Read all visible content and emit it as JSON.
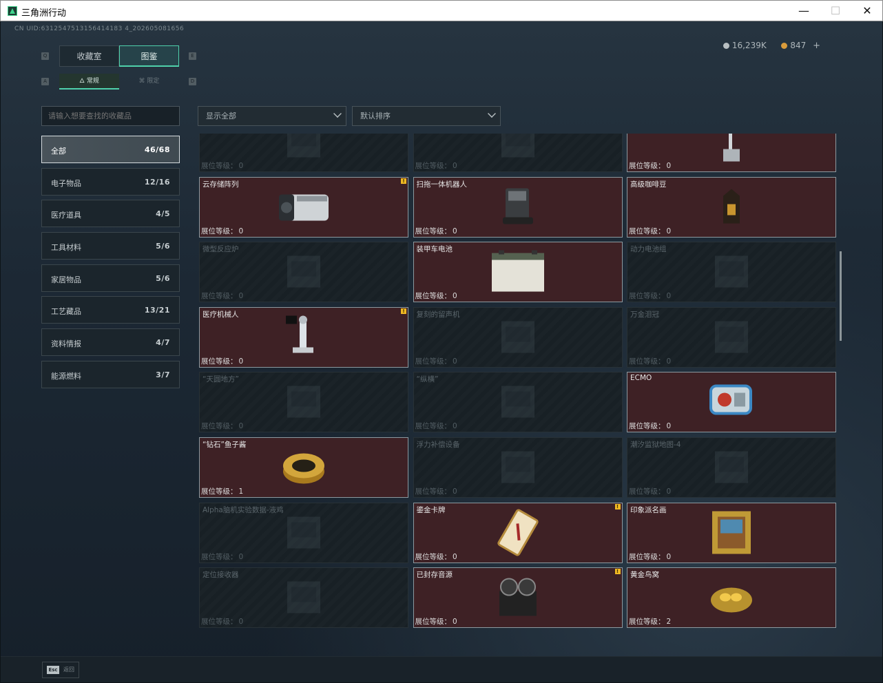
{
  "window": {
    "title": "三角洲行动",
    "min": "—",
    "max": "☐",
    "close": "✕"
  },
  "uid": "CN UID:6312547513156414183 4_202605081656",
  "currency": {
    "silver": "16,239K",
    "gold": "847",
    "plus": "+",
    "silver_color": "#b8bfc2",
    "gold_color": "#d89b3b"
  },
  "key_hints": {
    "q": "Q",
    "e": "E",
    "a": "A",
    "d": "D"
  },
  "main_tabs": [
    {
      "label": "收藏室",
      "active": false
    },
    {
      "label": "图鉴",
      "active": true
    }
  ],
  "sub_tabs": [
    {
      "label": "常规",
      "icon": "🜂",
      "active": true
    },
    {
      "label": "限定",
      "icon": "⌘",
      "active": false
    }
  ],
  "search": {
    "placeholder": "请输入想要查找的收藏品"
  },
  "categories": [
    {
      "label": "全部",
      "count": "46/68",
      "active": true
    },
    {
      "label": "电子物品",
      "count": "12/16"
    },
    {
      "label": "医疗道具",
      "count": "4/5"
    },
    {
      "label": "工具材料",
      "count": "5/6"
    },
    {
      "label": "家居物品",
      "count": "5/6"
    },
    {
      "label": "工艺藏品",
      "count": "13/21"
    },
    {
      "label": "资料情报",
      "count": "4/7"
    },
    {
      "label": "能源燃料",
      "count": "3/7"
    }
  ],
  "filters": {
    "show": "显示全部",
    "sort": "默认排序"
  },
  "level_label": "展位等级：",
  "items": [
    {
      "name": "",
      "level": "0",
      "owned": false,
      "icon": "box-icon"
    },
    {
      "name": "",
      "level": "0",
      "owned": false,
      "icon": "printer-icon"
    },
    {
      "name": "",
      "level": "0",
      "owned": true,
      "icon": "floor-cleaner-icon"
    },
    {
      "name": "云存储阵列",
      "level": "0",
      "owned": true,
      "new": true,
      "icon": "storage-array-icon"
    },
    {
      "name": "扫拖一体机器人",
      "level": "0",
      "owned": true,
      "icon": "robot-vacuum-icon"
    },
    {
      "name": "高级咖啡豆",
      "level": "0",
      "owned": true,
      "icon": "coffee-bag-icon"
    },
    {
      "name": "微型反应炉",
      "level": "0",
      "owned": false,
      "icon": "reactor-icon"
    },
    {
      "name": "装甲车电池",
      "level": "0",
      "owned": true,
      "icon": "battery-icon"
    },
    {
      "name": "动力电池组",
      "level": "0",
      "owned": false,
      "icon": "battery-pack-icon"
    },
    {
      "name": "医疗机械人",
      "level": "0",
      "owned": true,
      "new": true,
      "icon": "medical-robot-icon"
    },
    {
      "name": "复刻的留声机",
      "level": "0",
      "owned": false,
      "icon": "gramophone-icon"
    },
    {
      "name": "万金泪冠",
      "level": "0",
      "owned": false,
      "icon": "crown-icon"
    },
    {
      "name": "“天圆地方”",
      "level": "0",
      "owned": false,
      "icon": "armillary-icon"
    },
    {
      "name": "“纵横”",
      "level": "0",
      "owned": false,
      "icon": "board-icon"
    },
    {
      "name": "ECMO",
      "level": "0",
      "owned": true,
      "icon": "ecmo-icon"
    },
    {
      "name": "“钻石”鱼子酱",
      "level": "1",
      "owned": true,
      "icon": "caviar-tin-icon"
    },
    {
      "name": "浮力补偿设备",
      "level": "0",
      "owned": false,
      "icon": "bcd-icon"
    },
    {
      "name": "潮汐监狱地图-4",
      "level": "0",
      "owned": false,
      "icon": "map-icon"
    },
    {
      "name": "Alpha脑机实验数据-液鸡",
      "level": "0",
      "owned": false,
      "icon": "data-drive-icon"
    },
    {
      "name": "鎏金卡牌",
      "level": "0",
      "owned": true,
      "new": true,
      "icon": "gilded-card-icon"
    },
    {
      "name": "印象派名画",
      "level": "0",
      "owned": true,
      "icon": "painting-icon"
    },
    {
      "name": "定位接收器",
      "level": "0",
      "owned": false,
      "icon": "receiver-icon"
    },
    {
      "name": "已封存音源",
      "level": "0",
      "owned": true,
      "new": true,
      "icon": "tape-recorder-icon"
    },
    {
      "name": "黄金鸟窝",
      "level": "2",
      "owned": true,
      "icon": "gold-nest-icon"
    }
  ],
  "footer": {
    "esc_key": "Esc",
    "esc_label": "返回"
  }
}
